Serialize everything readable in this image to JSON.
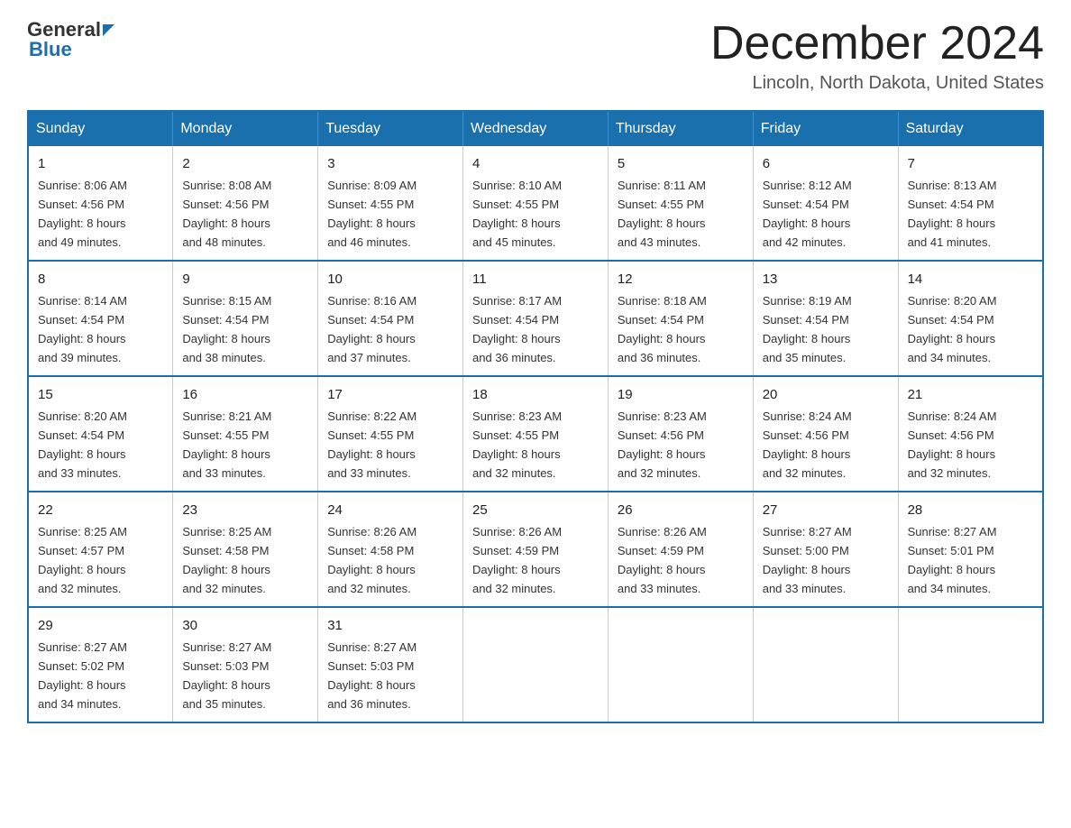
{
  "header": {
    "logo_general": "General",
    "logo_blue": "Blue",
    "month_title": "December 2024",
    "location": "Lincoln, North Dakota, United States"
  },
  "weekdays": [
    "Sunday",
    "Monday",
    "Tuesday",
    "Wednesday",
    "Thursday",
    "Friday",
    "Saturday"
  ],
  "weeks": [
    [
      {
        "day": "1",
        "sunrise": "8:06 AM",
        "sunset": "4:56 PM",
        "daylight": "8 hours and 49 minutes."
      },
      {
        "day": "2",
        "sunrise": "8:08 AM",
        "sunset": "4:56 PM",
        "daylight": "8 hours and 48 minutes."
      },
      {
        "day": "3",
        "sunrise": "8:09 AM",
        "sunset": "4:55 PM",
        "daylight": "8 hours and 46 minutes."
      },
      {
        "day": "4",
        "sunrise": "8:10 AM",
        "sunset": "4:55 PM",
        "daylight": "8 hours and 45 minutes."
      },
      {
        "day": "5",
        "sunrise": "8:11 AM",
        "sunset": "4:55 PM",
        "daylight": "8 hours and 43 minutes."
      },
      {
        "day": "6",
        "sunrise": "8:12 AM",
        "sunset": "4:54 PM",
        "daylight": "8 hours and 42 minutes."
      },
      {
        "day": "7",
        "sunrise": "8:13 AM",
        "sunset": "4:54 PM",
        "daylight": "8 hours and 41 minutes."
      }
    ],
    [
      {
        "day": "8",
        "sunrise": "8:14 AM",
        "sunset": "4:54 PM",
        "daylight": "8 hours and 39 minutes."
      },
      {
        "day": "9",
        "sunrise": "8:15 AM",
        "sunset": "4:54 PM",
        "daylight": "8 hours and 38 minutes."
      },
      {
        "day": "10",
        "sunrise": "8:16 AM",
        "sunset": "4:54 PM",
        "daylight": "8 hours and 37 minutes."
      },
      {
        "day": "11",
        "sunrise": "8:17 AM",
        "sunset": "4:54 PM",
        "daylight": "8 hours and 36 minutes."
      },
      {
        "day": "12",
        "sunrise": "8:18 AM",
        "sunset": "4:54 PM",
        "daylight": "8 hours and 36 minutes."
      },
      {
        "day": "13",
        "sunrise": "8:19 AM",
        "sunset": "4:54 PM",
        "daylight": "8 hours and 35 minutes."
      },
      {
        "day": "14",
        "sunrise": "8:20 AM",
        "sunset": "4:54 PM",
        "daylight": "8 hours and 34 minutes."
      }
    ],
    [
      {
        "day": "15",
        "sunrise": "8:20 AM",
        "sunset": "4:54 PM",
        "daylight": "8 hours and 33 minutes."
      },
      {
        "day": "16",
        "sunrise": "8:21 AM",
        "sunset": "4:55 PM",
        "daylight": "8 hours and 33 minutes."
      },
      {
        "day": "17",
        "sunrise": "8:22 AM",
        "sunset": "4:55 PM",
        "daylight": "8 hours and 33 minutes."
      },
      {
        "day": "18",
        "sunrise": "8:23 AM",
        "sunset": "4:55 PM",
        "daylight": "8 hours and 32 minutes."
      },
      {
        "day": "19",
        "sunrise": "8:23 AM",
        "sunset": "4:56 PM",
        "daylight": "8 hours and 32 minutes."
      },
      {
        "day": "20",
        "sunrise": "8:24 AM",
        "sunset": "4:56 PM",
        "daylight": "8 hours and 32 minutes."
      },
      {
        "day": "21",
        "sunrise": "8:24 AM",
        "sunset": "4:56 PM",
        "daylight": "8 hours and 32 minutes."
      }
    ],
    [
      {
        "day": "22",
        "sunrise": "8:25 AM",
        "sunset": "4:57 PM",
        "daylight": "8 hours and 32 minutes."
      },
      {
        "day": "23",
        "sunrise": "8:25 AM",
        "sunset": "4:58 PM",
        "daylight": "8 hours and 32 minutes."
      },
      {
        "day": "24",
        "sunrise": "8:26 AM",
        "sunset": "4:58 PM",
        "daylight": "8 hours and 32 minutes."
      },
      {
        "day": "25",
        "sunrise": "8:26 AM",
        "sunset": "4:59 PM",
        "daylight": "8 hours and 32 minutes."
      },
      {
        "day": "26",
        "sunrise": "8:26 AM",
        "sunset": "4:59 PM",
        "daylight": "8 hours and 33 minutes."
      },
      {
        "day": "27",
        "sunrise": "8:27 AM",
        "sunset": "5:00 PM",
        "daylight": "8 hours and 33 minutes."
      },
      {
        "day": "28",
        "sunrise": "8:27 AM",
        "sunset": "5:01 PM",
        "daylight": "8 hours and 34 minutes."
      }
    ],
    [
      {
        "day": "29",
        "sunrise": "8:27 AM",
        "sunset": "5:02 PM",
        "daylight": "8 hours and 34 minutes."
      },
      {
        "day": "30",
        "sunrise": "8:27 AM",
        "sunset": "5:03 PM",
        "daylight": "8 hours and 35 minutes."
      },
      {
        "day": "31",
        "sunrise": "8:27 AM",
        "sunset": "5:03 PM",
        "daylight": "8 hours and 36 minutes."
      },
      null,
      null,
      null,
      null
    ]
  ],
  "labels": {
    "sunrise": "Sunrise:",
    "sunset": "Sunset:",
    "daylight": "Daylight:"
  }
}
